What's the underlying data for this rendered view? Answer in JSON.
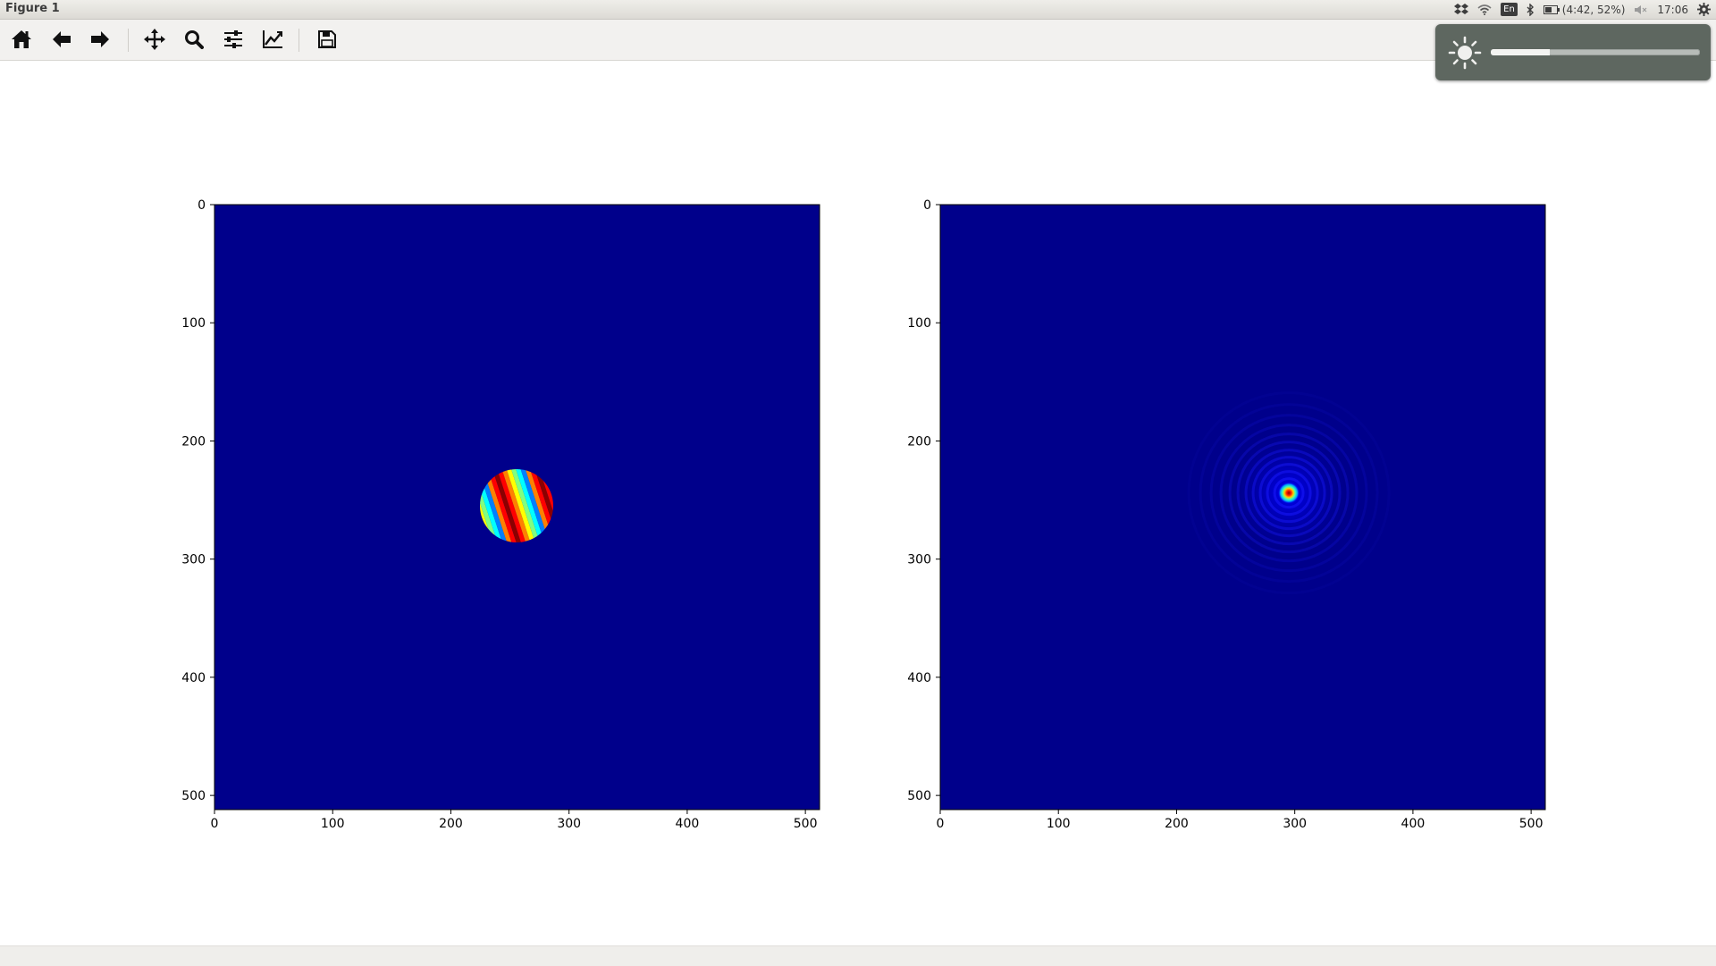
{
  "window": {
    "title": "Figure 1"
  },
  "system_tray": {
    "icons": [
      "dropbox-icon",
      "wifi-icon",
      "keyboard-layout-icon",
      "bluetooth-icon",
      "battery-icon",
      "volume-muted-icon",
      "gear-icon"
    ],
    "keyboard_layout": "En",
    "battery_text": "(4:42, 52%)",
    "clock": "17:06"
  },
  "toolbar": {
    "buttons": [
      {
        "name": "home-button",
        "icon": "home-icon"
      },
      {
        "name": "back-button",
        "icon": "arrow-left-icon"
      },
      {
        "name": "forward-button",
        "icon": "arrow-right-icon"
      },
      {
        "name": "pan-button",
        "icon": "move-icon"
      },
      {
        "name": "zoom-button",
        "icon": "zoom-icon"
      },
      {
        "name": "subplots-button",
        "icon": "sliders-icon"
      },
      {
        "name": "edit-axes-button",
        "icon": "line-chart-icon"
      },
      {
        "name": "save-button",
        "icon": "floppy-disk-icon"
      }
    ]
  },
  "brightness_osd": {
    "icon": "sun-icon",
    "level_fraction": 0.28
  },
  "colors": {
    "background": "#00008b",
    "toolbar": "#f2f1ef",
    "osd": "#5e6760"
  },
  "chart_data": [
    {
      "type": "heatmap",
      "title": "",
      "xlabel": "",
      "ylabel": "",
      "xlim": [
        0,
        512
      ],
      "ylim": [
        512,
        0
      ],
      "x_ticks": [
        "0",
        "100",
        "200",
        "300",
        "400",
        "500"
      ],
      "y_ticks": [
        "0",
        "100",
        "200",
        "300",
        "400",
        "500"
      ],
      "colormap": "jet",
      "features": [
        {
          "shape": "disk-with-diagonal-fringes",
          "center": [
            256,
            255
          ],
          "radius": 32
        }
      ]
    },
    {
      "type": "heatmap",
      "title": "",
      "xlabel": "",
      "ylabel": "",
      "xlim": [
        0,
        512
      ],
      "ylim": [
        512,
        0
      ],
      "x_ticks": [
        "0",
        "100",
        "200",
        "300",
        "400",
        "500"
      ],
      "y_ticks": [
        "0",
        "100",
        "200",
        "300",
        "400",
        "500"
      ],
      "colormap": "jet",
      "features": [
        {
          "shape": "airy-pattern-peak",
          "center": [
            295,
            244
          ],
          "radius": 8
        }
      ]
    }
  ]
}
